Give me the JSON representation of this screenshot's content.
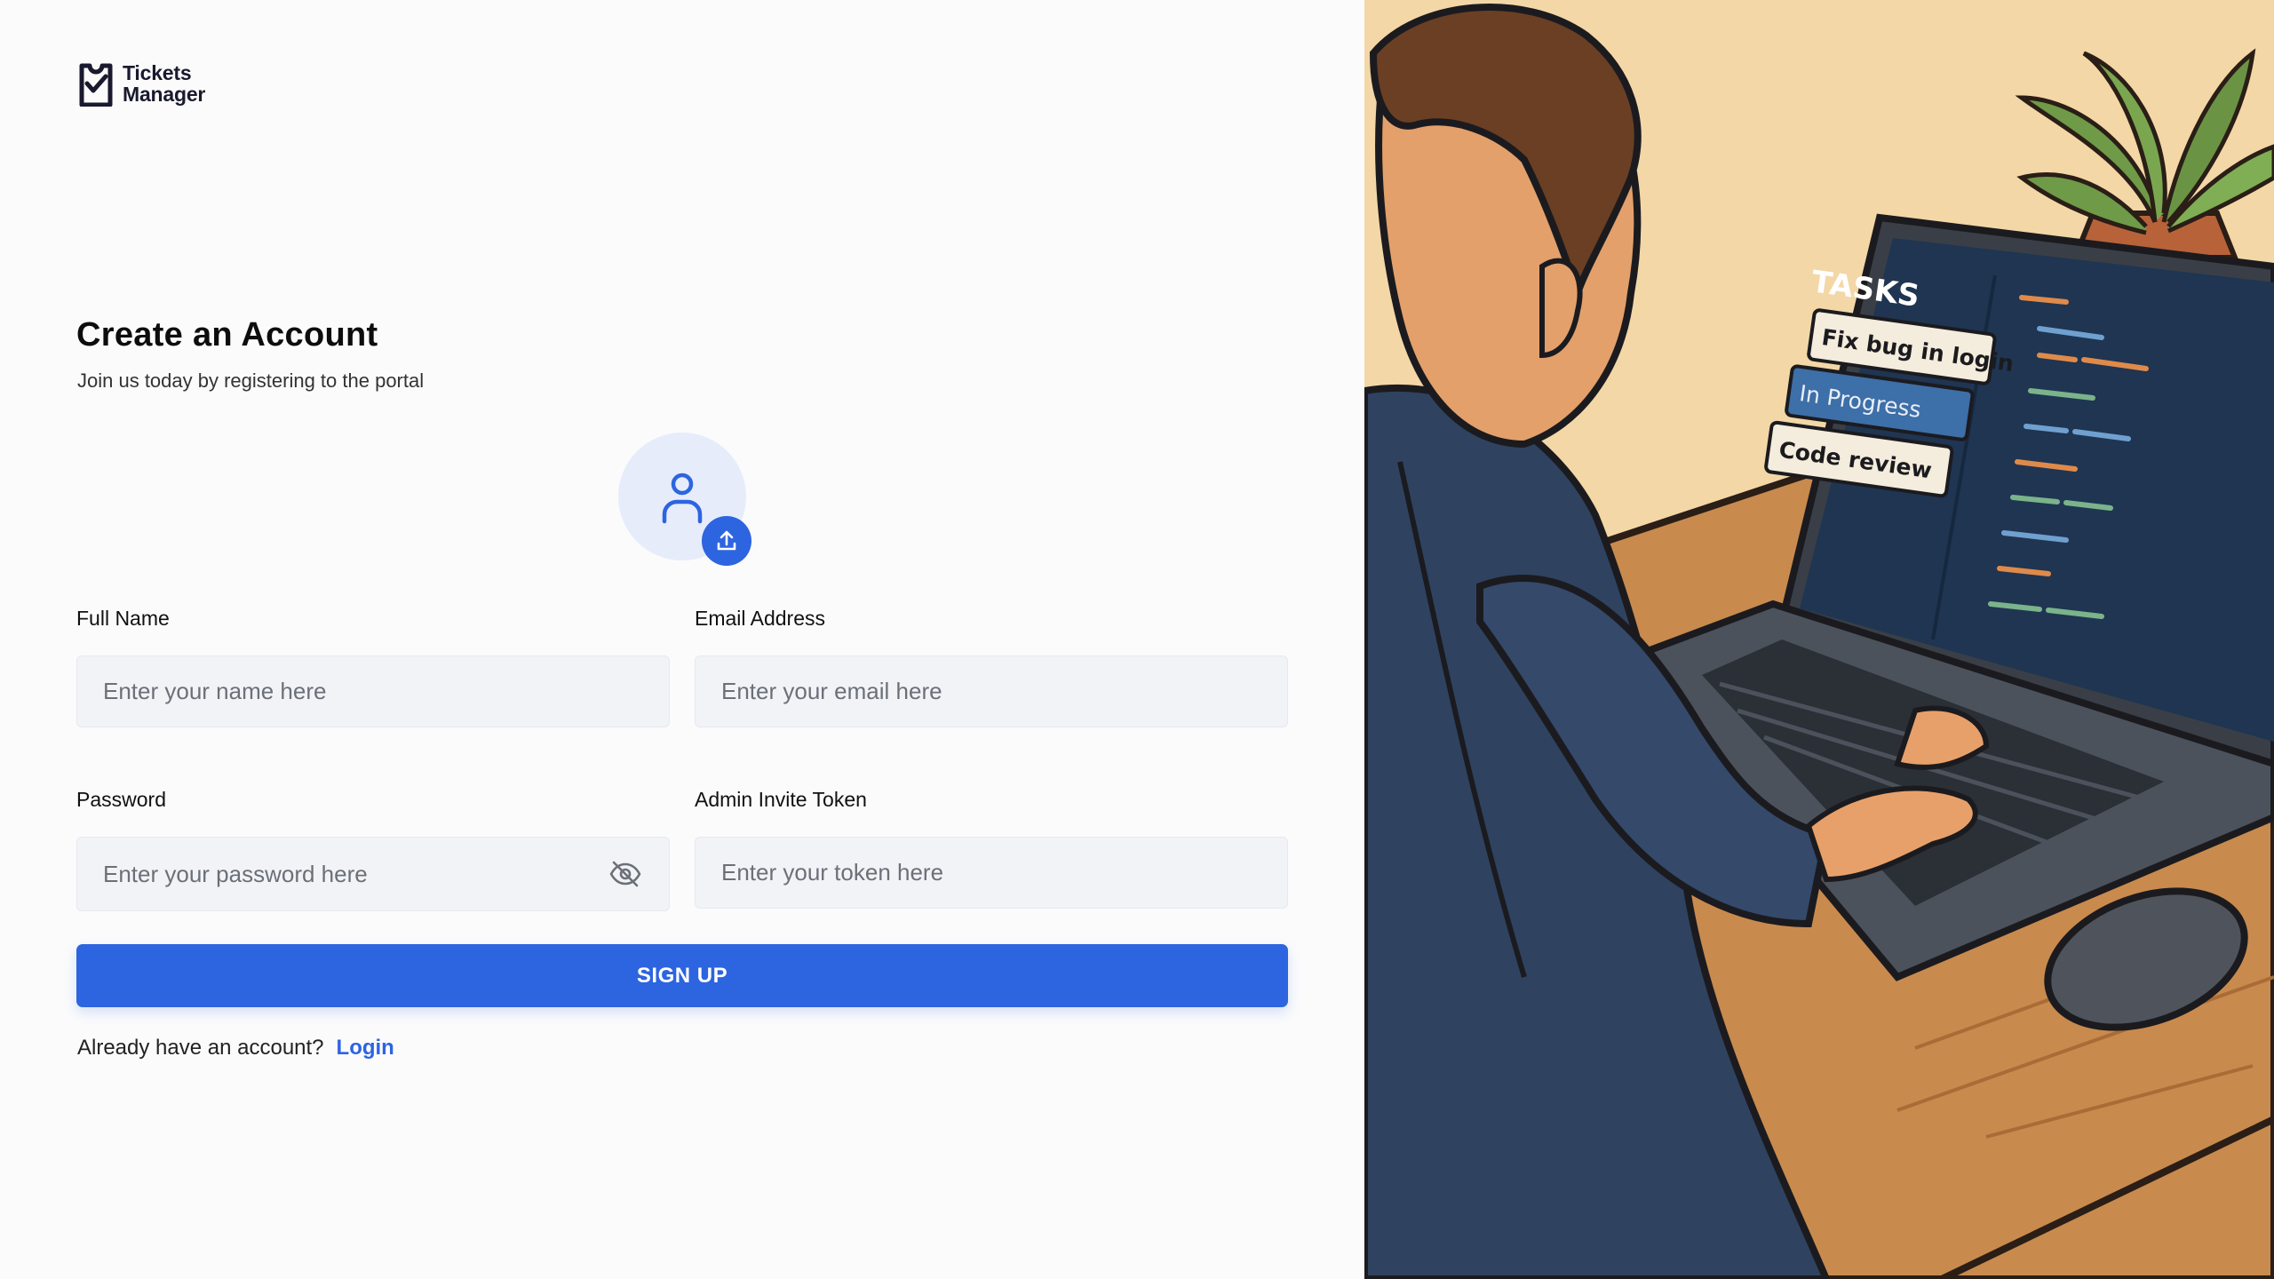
{
  "brand": {
    "line1": "Tickets",
    "line2": "Manager"
  },
  "header": {
    "title": "Create an Account",
    "subtitle": "Join us today by registering to the portal"
  },
  "avatar": {
    "icon": "user-icon",
    "upload_icon": "upload-icon"
  },
  "form": {
    "full_name": {
      "label": "Full Name",
      "placeholder": "Enter your name here",
      "value": ""
    },
    "email": {
      "label": "Email Address",
      "placeholder": "Enter your email here",
      "value": ""
    },
    "password": {
      "label": "Password",
      "placeholder": "Enter your password here",
      "value": "",
      "toggle_icon": "eye-off-icon"
    },
    "token": {
      "label": "Admin Invite Token",
      "placeholder": "Enter your token here",
      "value": ""
    },
    "submit_label": "SIGN UP"
  },
  "footer": {
    "prompt": "Already have an account?",
    "link_label": "Login"
  },
  "illustration": {
    "screen_title": "TASKS",
    "cards": [
      "Fix bug in login",
      "In Progress",
      "Code review"
    ]
  },
  "colors": {
    "accent": "#2d64e0",
    "avatar_bg": "#e6ecfa",
    "input_bg": "#f1f3f6"
  }
}
